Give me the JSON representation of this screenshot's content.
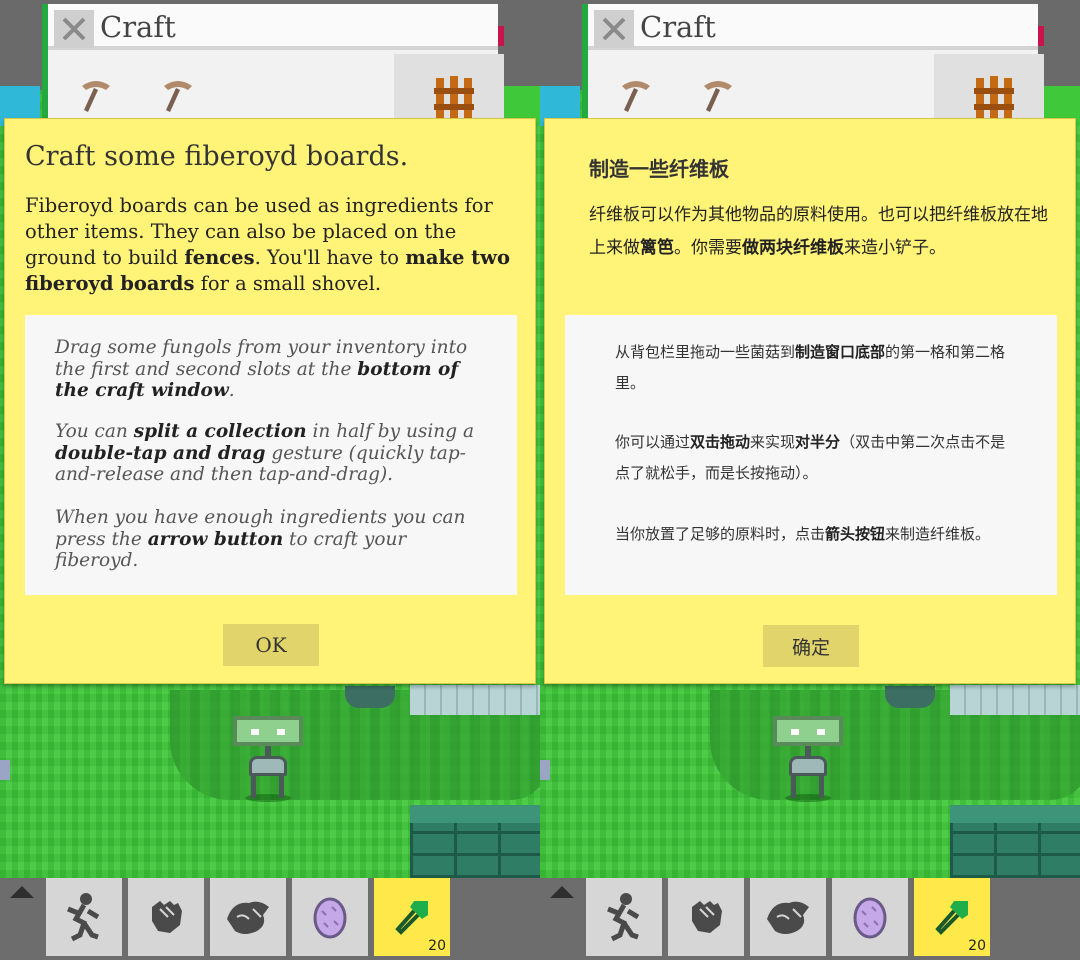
{
  "panels": [
    {
      "lang": "en",
      "craft_window": {
        "title": "Craft"
      },
      "dialog": {
        "title": "Craft some fiberoyd boards.",
        "desc_1": "Fiberoyd boards can be used as ingredients for other items. They can also be placed on the ground to build ",
        "desc_b1": "fences",
        "desc_2": ". You'll have to ",
        "desc_b2": "make two fiberoyd boards",
        "desc_3": " for a small shovel.",
        "tip1_a": "Drag some fungols from your inventory into the first and second slots at the ",
        "tip1_b": "bottom of the craft window",
        "tip1_c": ".",
        "tip2_a": "You can ",
        "tip2_b": "split a collection",
        "tip2_c": " in half by using a ",
        "tip2_d": "double-tap and drag",
        "tip2_e": " gesture (quickly tap-and-release and then tap-and-drag).",
        "tip3_a": "When you have enough ingredients you can press the ",
        "tip3_b": "arrow button",
        "tip3_c": " to craft your fiberoyd.",
        "ok_label": "OK"
      },
      "hotbar": {
        "active_count": "20"
      }
    },
    {
      "lang": "zh",
      "craft_window": {
        "title": "Craft"
      },
      "dialog": {
        "title": "制造一些纤维板",
        "desc_1": "纤维板可以作为其他物品的原料使用。也可以把纤维板放在地上来做",
        "desc_b1": "篱笆",
        "desc_2": "。你需要",
        "desc_b2": "做两块纤维板",
        "desc_3": "来造小铲子。",
        "tip1_a": "从背包栏里拖动一些菌菇到",
        "tip1_b": "制造窗口底部",
        "tip1_c": "的第一格和第二格里。",
        "tip2_a": "你可以通过",
        "tip2_b": "双击拖动",
        "tip2_c": "来实现",
        "tip2_d": "对半分",
        "tip2_e": "（双击中第二次点击不是点了就松手，而是长按拖动）。",
        "tip3_a": "当你放置了足够的原料时，点击",
        "tip3_b": "箭头按钮",
        "tip3_c": "来制造纤维板。",
        "ok_label": "确定"
      },
      "hotbar": {
        "active_count": "20"
      }
    }
  ],
  "colors": {
    "dialog_bg": "#fff378",
    "grass": "#3fc83a",
    "hotbar_active": "#ffe94a"
  },
  "icons": [
    "close-icon",
    "pickaxe-icon",
    "fence-icon",
    "creature-icon",
    "glove-icon",
    "bird-icon",
    "egg-icon",
    "shovel-icon",
    "arrow-up-icon"
  ]
}
